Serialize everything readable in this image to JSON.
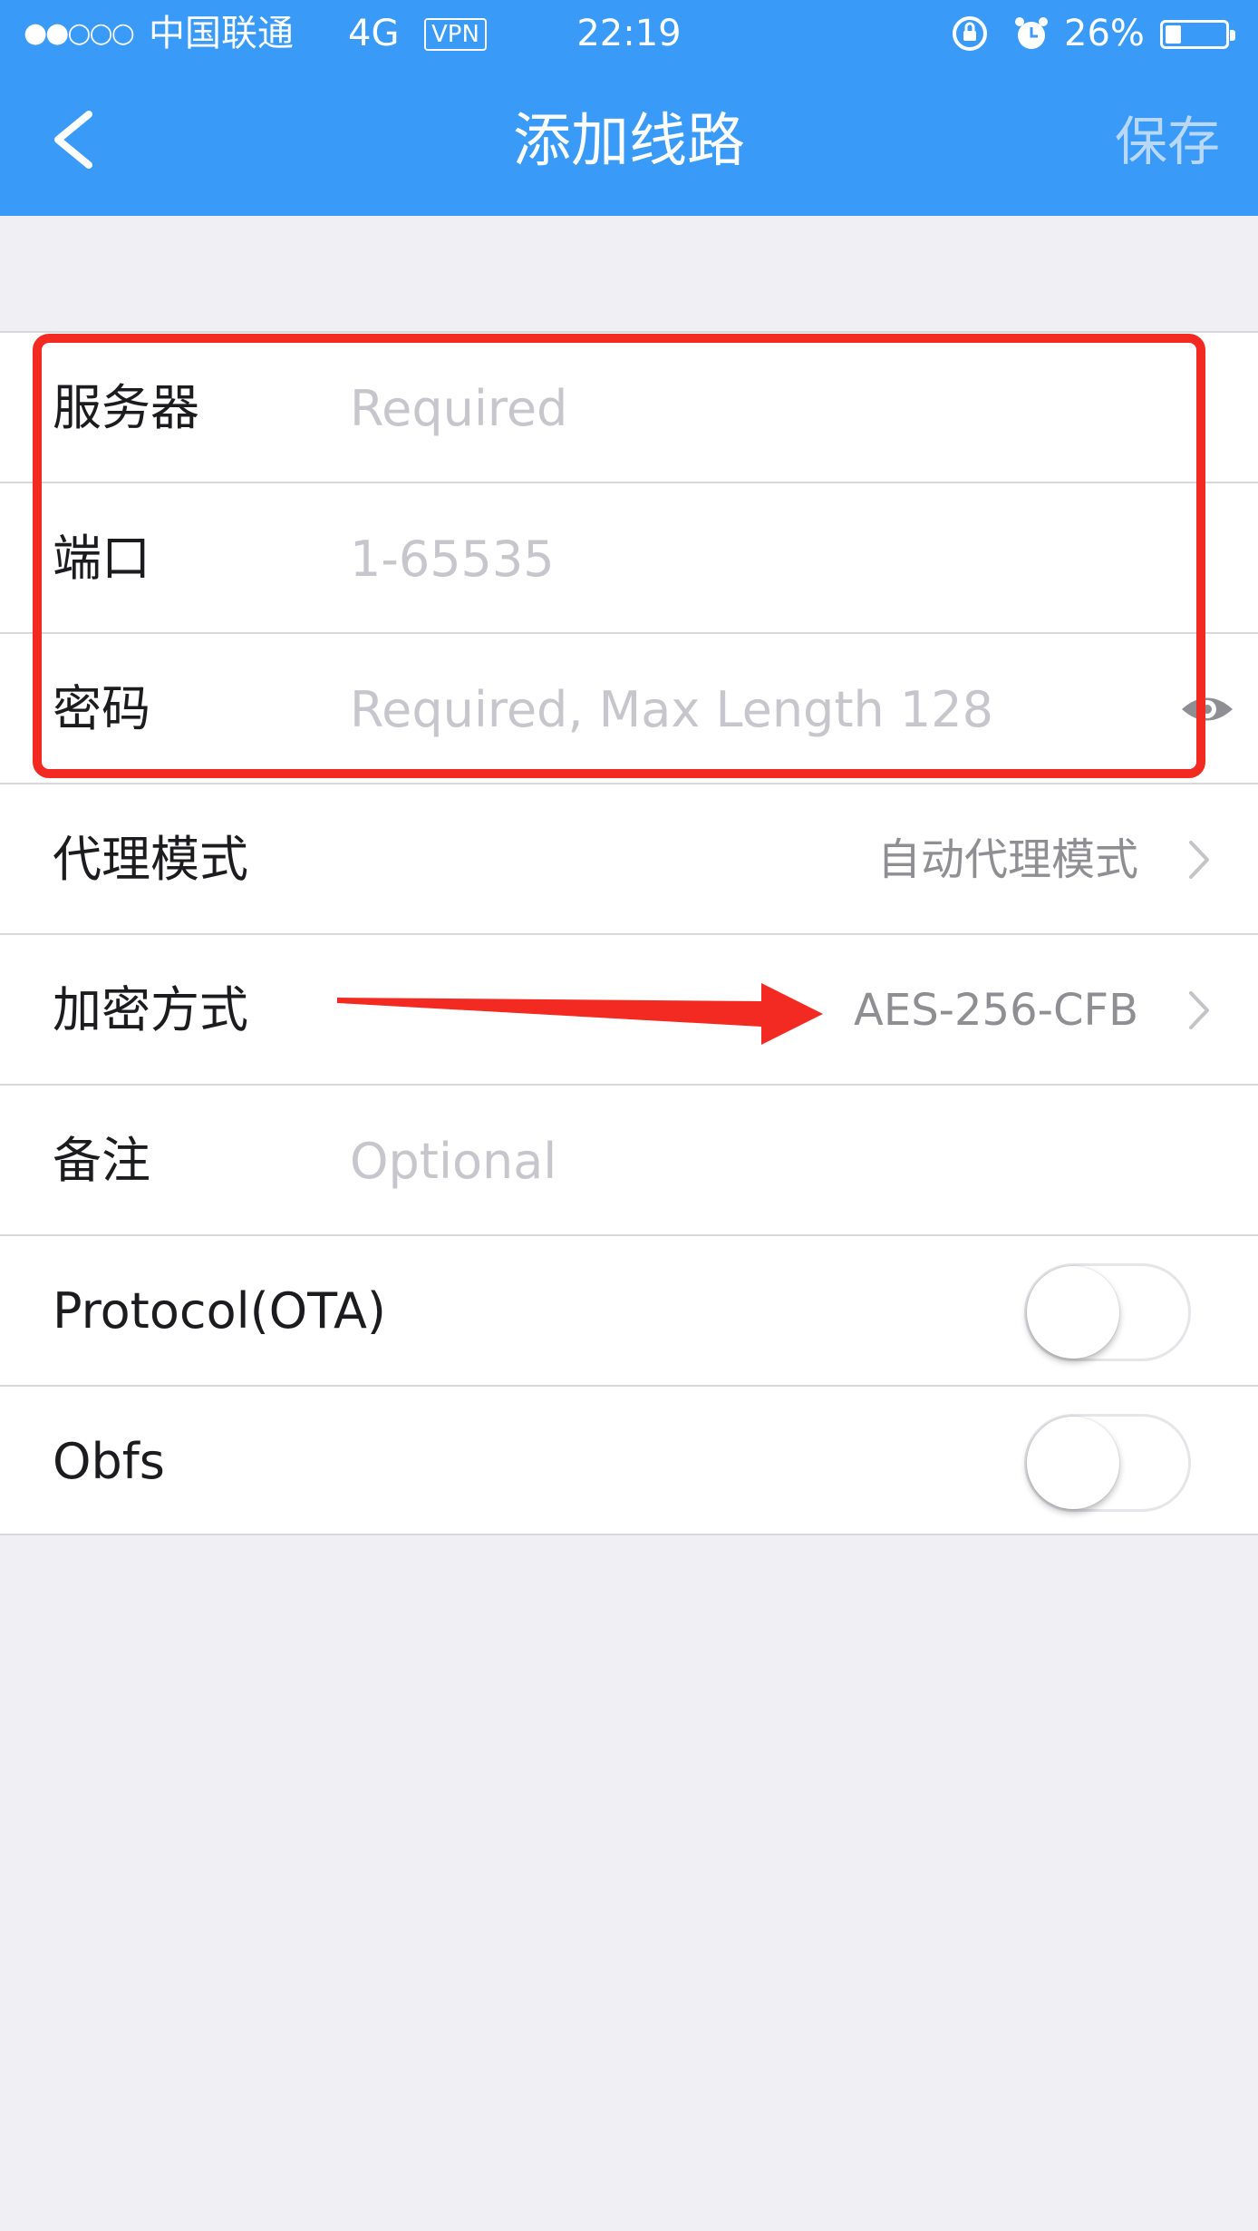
{
  "status_bar": {
    "signal": "●●○○○",
    "carrier": "中国联通",
    "network": "4G",
    "vpn": "VPN",
    "time": "22:19",
    "battery_percent": "26%",
    "battery_level": 0.26,
    "icons": [
      "rotation-lock-icon",
      "alarm-icon",
      "battery-icon"
    ]
  },
  "nav": {
    "back_icon": "chevron-left-icon",
    "title": "添加线路",
    "save_label": "保存"
  },
  "form": {
    "server": {
      "label": "服务器",
      "placeholder": "Required",
      "value": ""
    },
    "port": {
      "label": "端口",
      "placeholder": "1-65535",
      "value": ""
    },
    "password": {
      "label": "密码",
      "placeholder": "Required, Max Length 128",
      "value": "",
      "icon": "eye-icon"
    },
    "proxy_mode": {
      "label": "代理模式",
      "value": "自动代理模式"
    },
    "encryption": {
      "label": "加密方式",
      "value": "AES-256-CFB"
    },
    "note": {
      "label": "备注",
      "placeholder": "Optional",
      "value": ""
    },
    "protocol_ota": {
      "label": "Protocol(OTA)",
      "enabled": false
    },
    "obfs": {
      "label": "Obfs",
      "enabled": false
    }
  },
  "colors": {
    "nav_background": "#3a9af7",
    "page_background": "#efeff4",
    "annotation_red": "#f22a22"
  }
}
